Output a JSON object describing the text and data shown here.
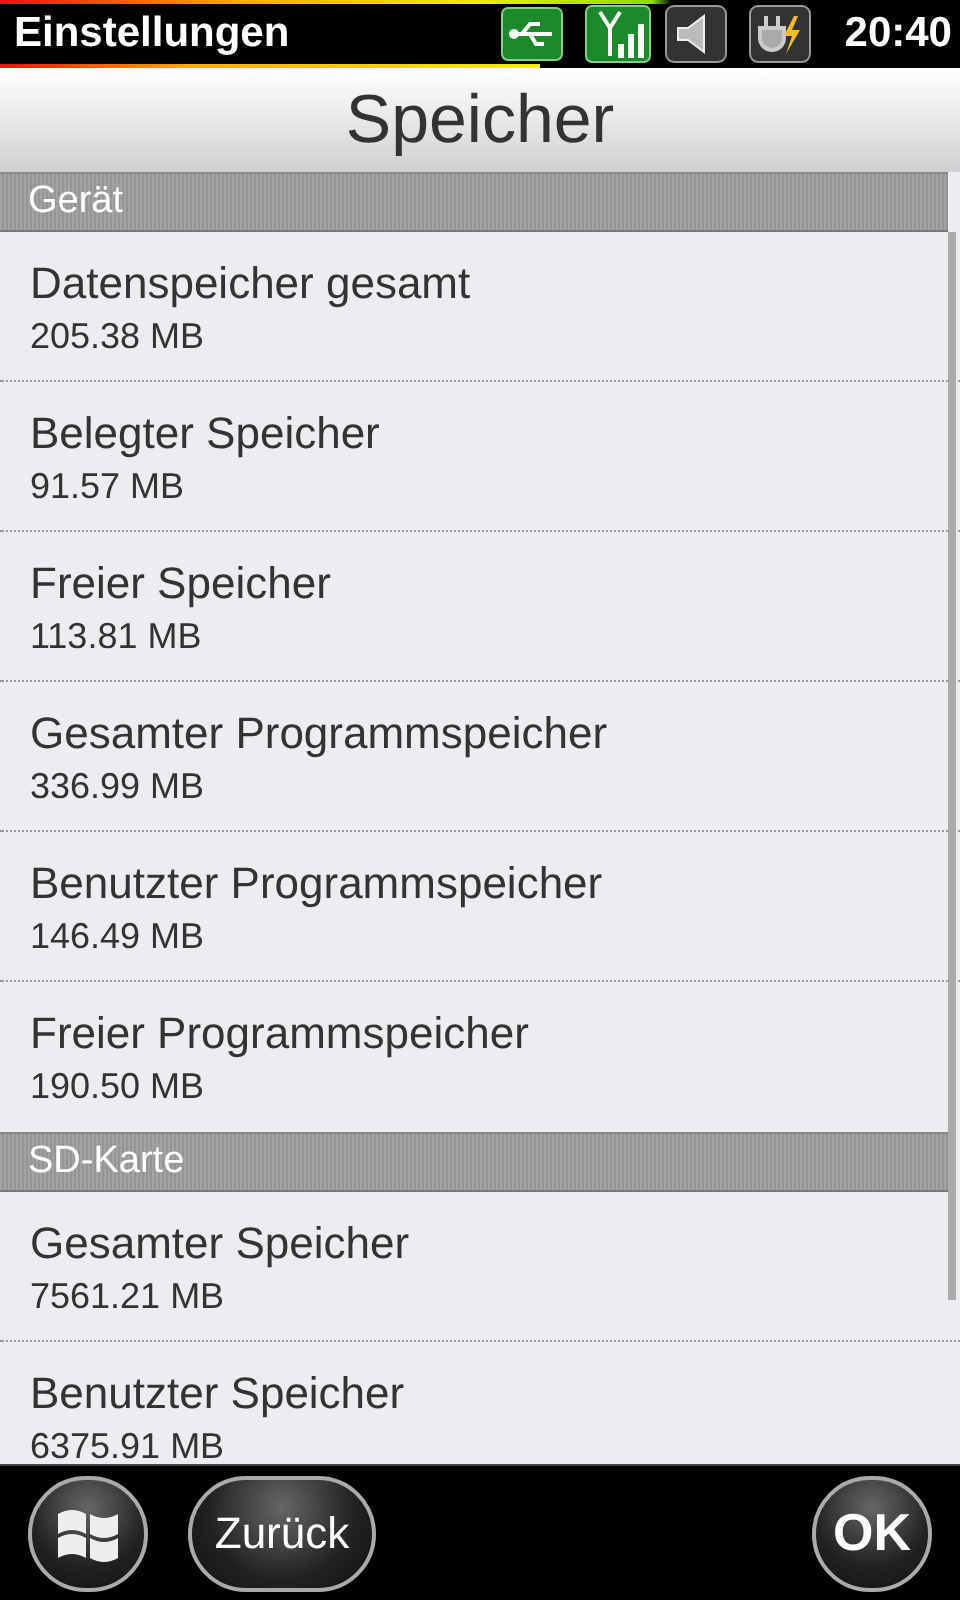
{
  "status_bar": {
    "title": "Einstellungen",
    "time": "20:40"
  },
  "page_title": "Speicher",
  "sections": [
    {
      "header": "Gerät",
      "items": [
        {
          "name": "Datenspeicher gesamt",
          "value": "205.38 MB"
        },
        {
          "name": "Belegter Speicher",
          "value": "91.57 MB"
        },
        {
          "name": "Freier Speicher",
          "value": "113.81 MB"
        },
        {
          "name": "Gesamter Programmspeicher",
          "value": "336.99 MB"
        },
        {
          "name": "Benutzter Programmspeicher",
          "value": "146.49 MB"
        },
        {
          "name": "Freier Programmspeicher",
          "value": "190.50 MB"
        }
      ]
    },
    {
      "header": "SD-Karte",
      "items": [
        {
          "name": "Gesamter Speicher",
          "value": "7561.21 MB"
        },
        {
          "name": "Benutzter Speicher",
          "value": "6375.91 MB"
        }
      ]
    }
  ],
  "soft_keys": {
    "back": "Zurück",
    "ok": "OK"
  }
}
